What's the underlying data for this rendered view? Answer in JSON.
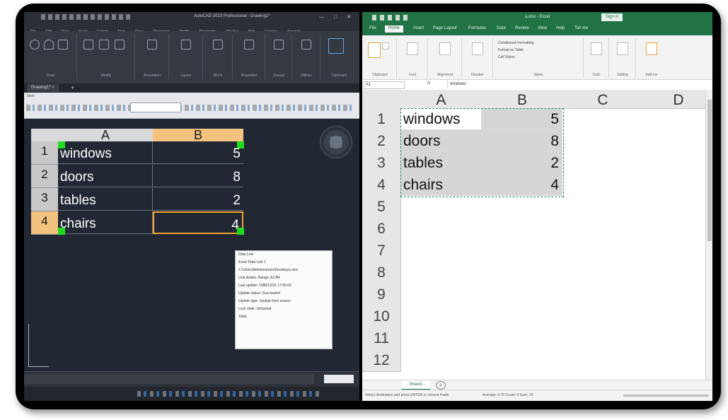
{
  "autocad": {
    "title": "AutoCAD 2023 Professional - Drawing1*",
    "window_controls": "— □ ✕",
    "menu": [
      "File",
      "Edit",
      "View",
      "Insert",
      "Format",
      "Tools",
      "Draw",
      "Dimension",
      "Modify",
      "Parametric",
      "Window",
      "Help",
      "Express",
      "Annotate"
    ],
    "ribbon_groups": [
      "Draw",
      "Modify",
      "Annotation",
      "Layers",
      "Block",
      "Properties",
      "Groups",
      "Utilities",
      "Clipboard"
    ],
    "doc_tab": "Drawing1* ×",
    "doc_tab_plus": "+",
    "toolbar_label": "Table",
    "table": {
      "columns": [
        "A",
        "B"
      ],
      "rows": [
        {
          "n": "1",
          "name": "windows",
          "qty": "5"
        },
        {
          "n": "2",
          "name": "doors",
          "qty": "8"
        },
        {
          "n": "3",
          "name": "tables",
          "qty": "2"
        },
        {
          "n": "4",
          "name": "chairs",
          "qty": "4"
        }
      ]
    },
    "tooltip": [
      "Data Link",
      "Excel Data Link 1",
      "C:\\Users\\Administrator\\Desktop\\a.xlsx",
      "Link details: Range: A1:B4",
      "Last update: 1986/12/31 17:00:00",
      "Update status: Succeeded",
      "Update type: Update from source",
      "Lock state: Unlocked",
      "",
      "Table"
    ]
  },
  "excel": {
    "title": "a.xlsx - Excel",
    "sign_in": "Sign in",
    "tabs": [
      "File",
      "Home",
      "Insert",
      "Page Layout",
      "Formulas",
      "Data",
      "Review",
      "View",
      "Help",
      "Tell me"
    ],
    "active_tab": "Home",
    "ribbon_groups": [
      "Clipboard",
      "Font",
      "Alignment",
      "Number",
      "Styles",
      "Cells",
      "Editing",
      "Add-ins"
    ],
    "styles_items": [
      "Conditional Formatting",
      "Format as Table",
      "Cell Styles"
    ],
    "name_box": "A1",
    "fx": "fx",
    "formula_value": "windows",
    "columns": [
      "A",
      "B",
      "C",
      "D"
    ],
    "row_numbers": [
      "1",
      "2",
      "3",
      "4",
      "5",
      "6",
      "7",
      "8",
      "9",
      "10",
      "11",
      "12"
    ],
    "rows": [
      {
        "name": "windows",
        "qty": "5"
      },
      {
        "name": "doors",
        "qty": "8"
      },
      {
        "name": "tables",
        "qty": "2"
      },
      {
        "name": "chairs",
        "qty": "4"
      }
    ],
    "sheet_tab": "Sheet1",
    "add_sheet": "+",
    "status_message": "Select destination and press ENTER or choose Paste",
    "status_stats": "Average: 4.75    Count: 8    Sum: 19"
  }
}
